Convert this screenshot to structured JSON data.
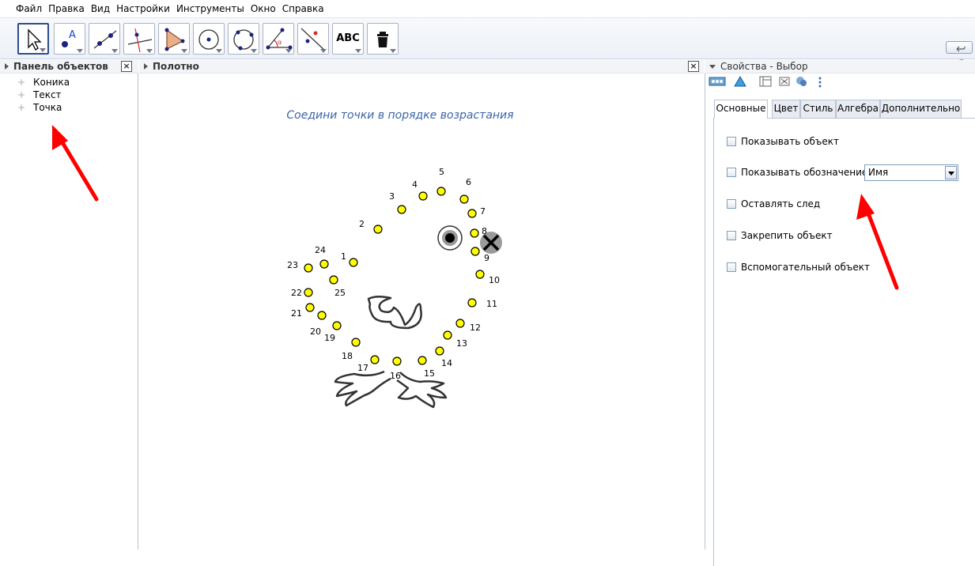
{
  "menu": [
    "Файл",
    "Правка",
    "Вид",
    "Настройки",
    "Инструменты",
    "Окно",
    "Справка"
  ],
  "toolbar": {
    "tools": [
      "move-tool",
      "point-tool",
      "line-tool",
      "perpendicular-tool",
      "polygon-tool",
      "circle-center-tool",
      "circle-three-points-tool",
      "angle-tool",
      "reflect-tool",
      "text-tool",
      "delete-tool"
    ],
    "text_tool_label": "ABC"
  },
  "algebra": {
    "title": "Панель объектов",
    "items": [
      "Коника",
      "Текст",
      "Точка"
    ]
  },
  "graphics": {
    "title": "Полотно",
    "caption": "Соедини точки в порядке возрастания",
    "points": [
      {
        "n": "1"
      },
      {
        "n": "2"
      },
      {
        "n": "3"
      },
      {
        "n": "4"
      },
      {
        "n": "5"
      },
      {
        "n": "6"
      },
      {
        "n": "7"
      },
      {
        "n": "8"
      },
      {
        "n": "9"
      },
      {
        "n": "10"
      },
      {
        "n": "11"
      },
      {
        "n": "12"
      },
      {
        "n": "13"
      },
      {
        "n": "14"
      },
      {
        "n": "15"
      },
      {
        "n": "16"
      },
      {
        "n": "17"
      },
      {
        "n": "18"
      },
      {
        "n": "19"
      },
      {
        "n": "20"
      },
      {
        "n": "21"
      },
      {
        "n": "22"
      },
      {
        "n": "23"
      },
      {
        "n": "24"
      },
      {
        "n": "25"
      }
    ],
    "point_color": "#ffff00",
    "stroke_color": "#333333"
  },
  "properties": {
    "title": "Свойства - Выбор",
    "tabs": [
      "Основные",
      "Цвет",
      "Стиль",
      "Алгебра",
      "Дополнительно"
    ],
    "active_tab": "Основные",
    "checkboxes": {
      "show_object": "Показывать объект",
      "show_label": "Показывать обозначение:",
      "trace": "Оставлять след",
      "fix": "Закрепить объект",
      "auxiliary": "Вспомогательный объект"
    },
    "label_select_value": "Имя"
  },
  "annotations": {
    "arrow_color": "#ff0000"
  }
}
